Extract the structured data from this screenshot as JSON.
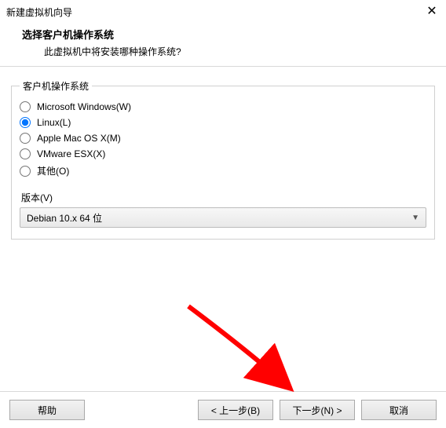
{
  "window": {
    "title": "新建虚拟机向导",
    "close_glyph": "✕"
  },
  "header": {
    "title": "选择客户机操作系统",
    "subtitle": "此虚拟机中将安装哪种操作系统?"
  },
  "os_group": {
    "legend": "客户机操作系统",
    "options": [
      {
        "label": "Microsoft Windows(W)",
        "selected": false
      },
      {
        "label": "Linux(L)",
        "selected": true
      },
      {
        "label": "Apple Mac OS X(M)",
        "selected": false
      },
      {
        "label": "VMware ESX(X)",
        "selected": false
      },
      {
        "label": "其他(O)",
        "selected": false
      }
    ],
    "version_label": "版本(V)",
    "version_selected": "Debian 10.x 64 位"
  },
  "buttons": {
    "help": "帮助",
    "back": "< 上一步(B)",
    "next": "下一步(N) >",
    "cancel": "取消"
  },
  "annotation": {
    "arrow_color": "#ff0000"
  }
}
